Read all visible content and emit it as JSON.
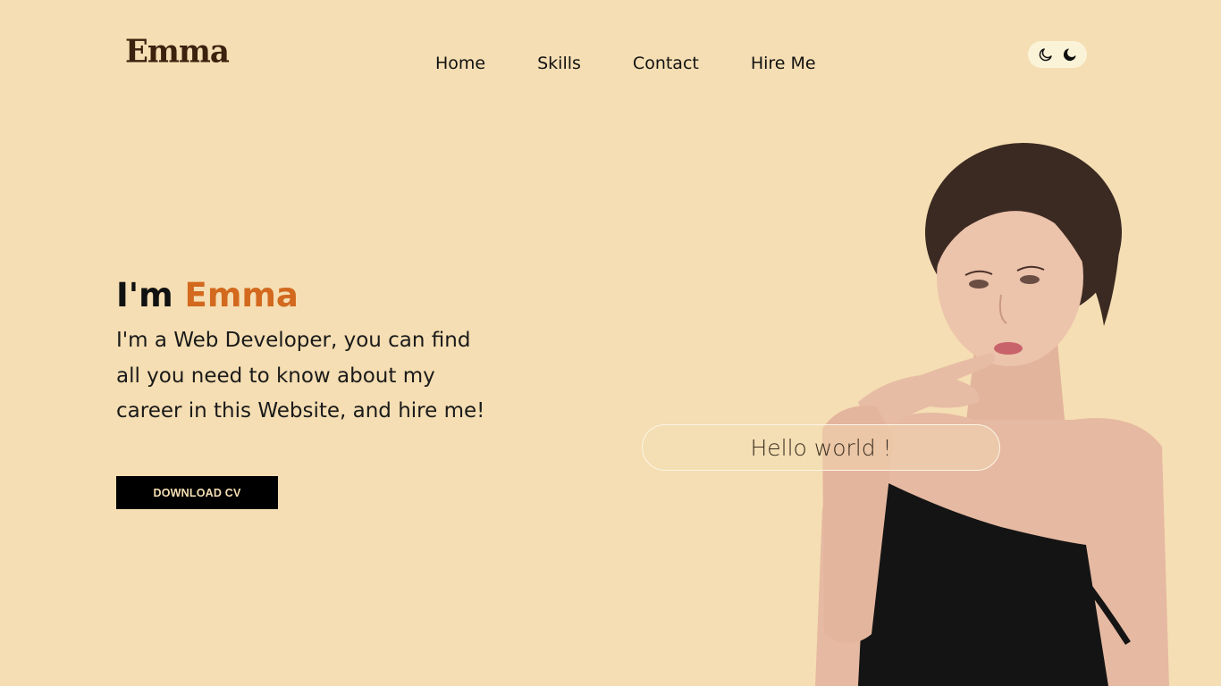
{
  "header": {
    "logo": "Emma",
    "nav": [
      {
        "label": "Home"
      },
      {
        "label": "Skills"
      },
      {
        "label": "Contact"
      },
      {
        "label": "Hire Me"
      }
    ],
    "theme_toggle": {
      "light_icon": "moon-outline-icon",
      "dark_icon": "moon-filled-icon"
    }
  },
  "hero": {
    "title_prefix": "I'm",
    "title_name": "Emma",
    "description": "I'm a Web Developer, you can find all you need to know about my career in this Website, and hire me!",
    "cv_button": "DOWNLOAD CV",
    "greeting": "Hello world !"
  },
  "colors": {
    "background": "#f5deb3",
    "accent": "#d2691e",
    "logo": "#3a220e",
    "button_bg": "#000000"
  }
}
